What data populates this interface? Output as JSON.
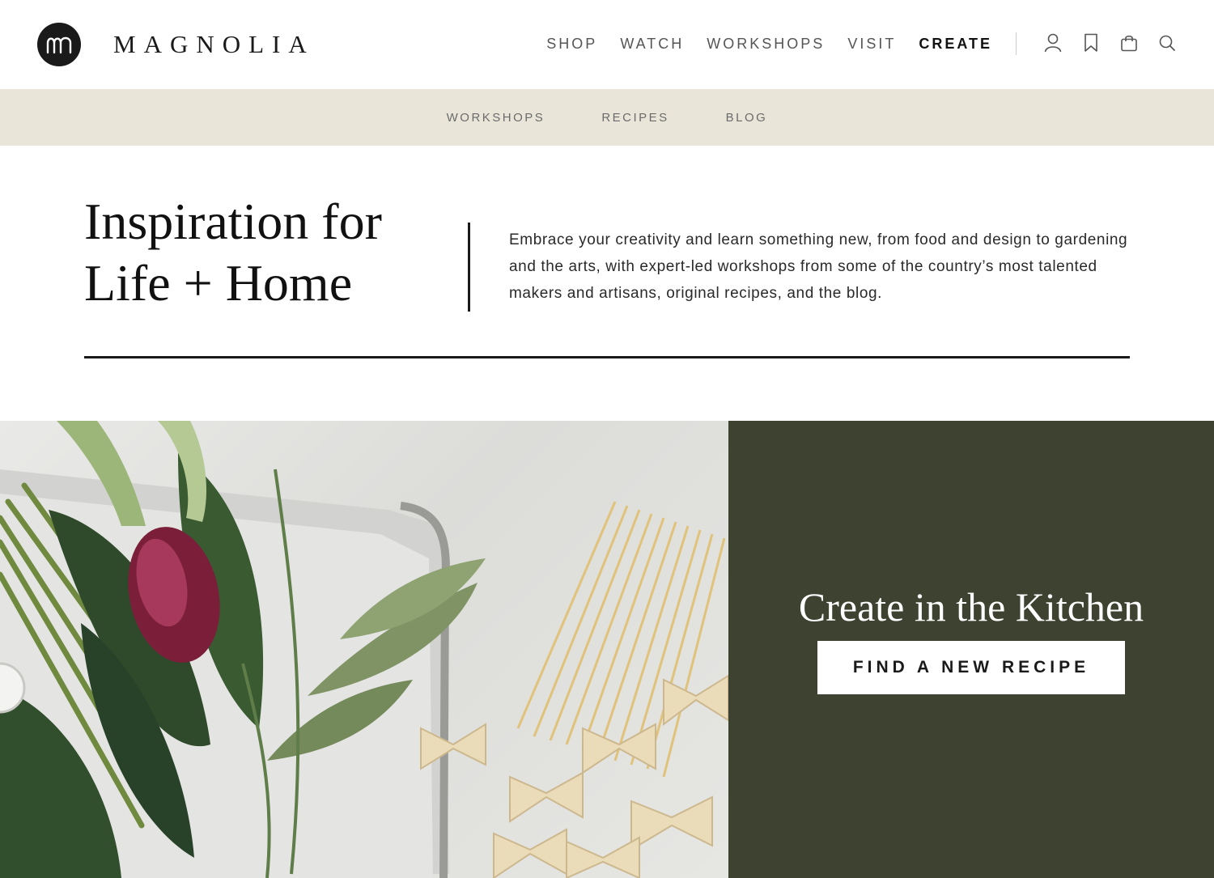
{
  "brand": {
    "name": "MAGNOLIA",
    "logo_icon": "magnolia-m-icon"
  },
  "main_nav": {
    "items": [
      {
        "label": "SHOP",
        "active": false
      },
      {
        "label": "WATCH",
        "active": false
      },
      {
        "label": "WORKSHOPS",
        "active": false
      },
      {
        "label": "VISIT",
        "active": false
      },
      {
        "label": "CREATE",
        "active": true
      }
    ],
    "icons": [
      "account-icon",
      "bookmark-icon",
      "bag-icon",
      "search-icon"
    ]
  },
  "sub_nav": {
    "items": [
      {
        "label": "WORKSHOPS"
      },
      {
        "label": "RECIPES"
      },
      {
        "label": "BLOG"
      }
    ]
  },
  "intro": {
    "title_line1": "Inspiration for",
    "title_line2": "Life + Home",
    "description": "Embrace your creativity and learn something new, from food and design to gardening and the arts, with expert-led workshops from some of the country’s most talented makers and artisans, original recipes, and the blog."
  },
  "feature": {
    "title": "Create in the Kitchen",
    "cta_label": "FIND A NEW RECIPE",
    "panel_color": "#3e4231"
  },
  "colors": {
    "subnav_bg": "#e9e6d9",
    "text_dark": "#1a1a1a",
    "nav_text": "#555555"
  }
}
